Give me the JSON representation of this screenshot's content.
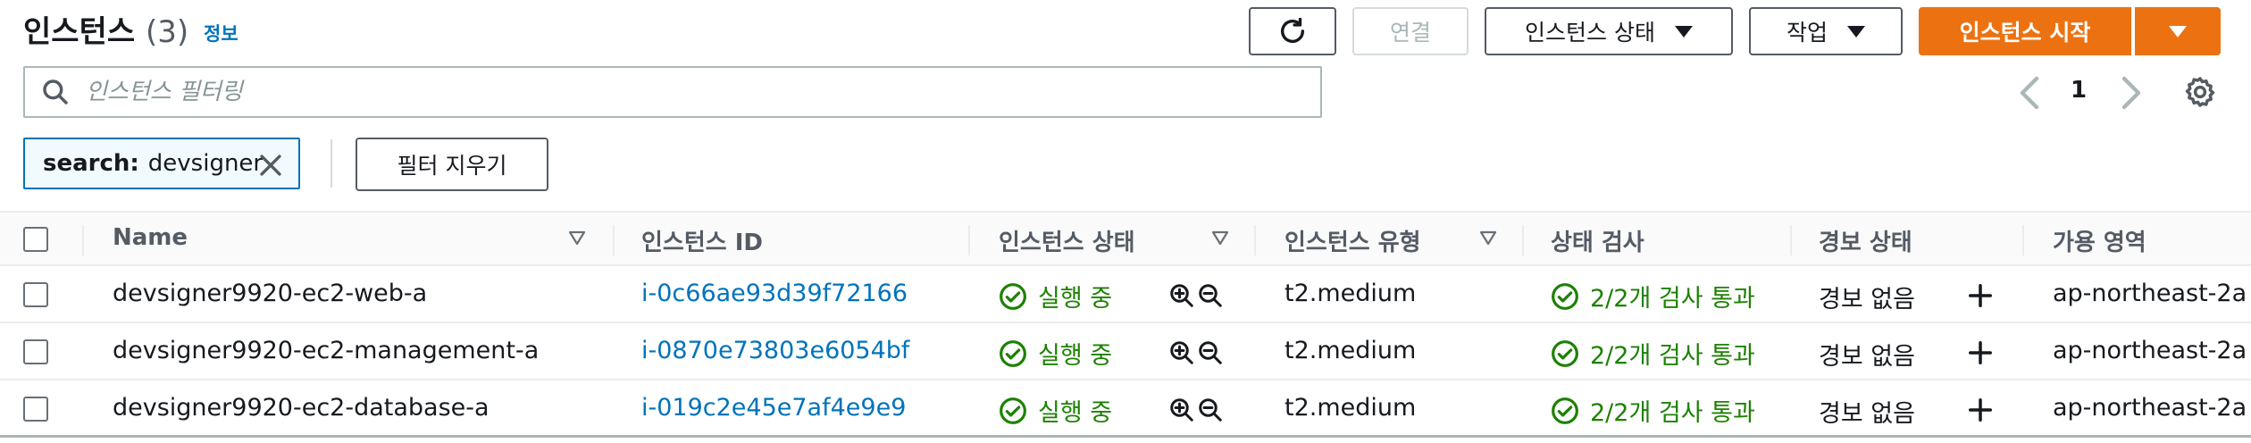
{
  "header": {
    "title": "인스턴스",
    "count": "(3)",
    "info_link": "정보",
    "connect_label": "연결",
    "instance_state_label": "인스턴스 상태",
    "actions_label": "작업",
    "launch_label": "인스턴스 시작"
  },
  "search": {
    "placeholder": "인스턴스 필터링"
  },
  "pagination": {
    "current_page": "1"
  },
  "filter_token": {
    "key": "search:",
    "value": "devsigner"
  },
  "clear_filters_label": "필터 지우기",
  "table": {
    "columns": [
      "Name",
      "인스턴스 ID",
      "인스턴스 상태",
      "인스턴스 유형",
      "상태 검사",
      "경보 상태",
      "가용 영역"
    ],
    "rows": [
      {
        "name": "devsigner9920-ec2-web-a",
        "instance_id": "i-0c66ae93d39f72166",
        "state": "실행 중",
        "type": "t2.medium",
        "status_check": "2/2개 검사 통과",
        "alarm": "경보 없음",
        "az": "ap-northeast-2a"
      },
      {
        "name": "devsigner9920-ec2-management-a",
        "instance_id": "i-0870e73803e6054bf",
        "state": "실행 중",
        "type": "t2.medium",
        "status_check": "2/2개 검사 통과",
        "alarm": "경보 없음",
        "az": "ap-northeast-2a"
      },
      {
        "name": "devsigner9920-ec2-database-a",
        "instance_id": "i-019c2e45e7af4e9e9",
        "state": "실행 중",
        "type": "t2.medium",
        "status_check": "2/2개 검사 통과",
        "alarm": "경보 없음",
        "az": "ap-northeast-2a"
      }
    ]
  },
  "icons": {
    "refresh": "refresh-icon",
    "search": "search-icon",
    "settings": "gear-icon",
    "close": "close-icon",
    "running": "check-circle-icon",
    "zoom_in": "zoom-in-icon",
    "zoom_out": "zoom-out-icon",
    "add_alarm": "plus-icon"
  },
  "colors": {
    "primary_orange": "#ec7211",
    "link_blue": "#0073bb",
    "success_green": "#1d8102"
  }
}
